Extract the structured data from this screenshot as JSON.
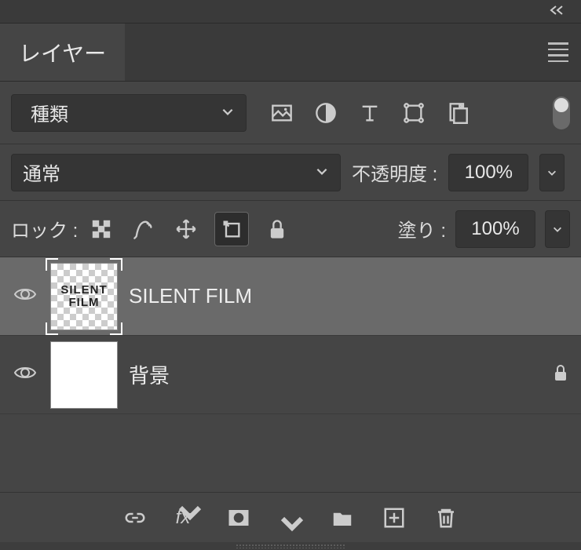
{
  "tab": {
    "title": "レイヤー"
  },
  "filter": {
    "kind": "種類"
  },
  "blend": {
    "mode": "通常",
    "opacity_label": "不透明度 :",
    "opacity": "100%"
  },
  "lock": {
    "label": "ロック :",
    "fill_label": "塗り :",
    "fill": "100%"
  },
  "layers": [
    {
      "name": "SILENT FILM",
      "thumb_text1": "SILENT",
      "thumb_text2": "FILM",
      "smart_object": true,
      "selected": true,
      "locked": false
    },
    {
      "name": "背景",
      "smart_object": false,
      "selected": false,
      "locked": true
    }
  ]
}
